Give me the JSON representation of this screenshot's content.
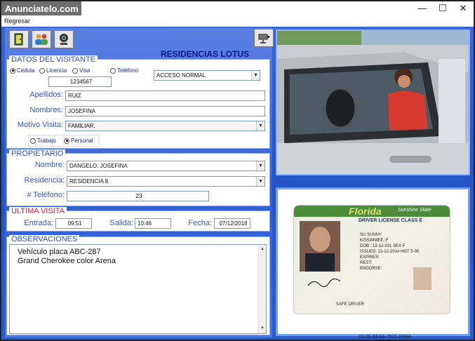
{
  "watermark": "Anunciatelo.com",
  "window_controls": {
    "minimize": "—",
    "maximize": "☐",
    "close": "✕"
  },
  "menu": {
    "regresar": "Regresar"
  },
  "app_title": "RESIDENCIAS LOTUS",
  "visitante": {
    "title": "DATOS DEL VISITANTE",
    "doc_types": [
      "Cédula",
      "Licencia",
      "Visa",
      "Teléfono"
    ],
    "doc_selected": "Cédula",
    "doc_number": "1234567",
    "access_type": "ACCESO NORMAL",
    "apellidos_label": "Apellidos:",
    "apellidos": "RUIZ",
    "nombres_label": "Nombres:",
    "nombres": "JOSEFINA",
    "motivo_label": "Motivo Visita:",
    "motivo": "FAMILIAR.",
    "visit_types": [
      "Trabajo",
      "Personal"
    ],
    "visit_selected": "Personal"
  },
  "propietario": {
    "title": "PROPIETARIO",
    "nombre_label": "Nombre:",
    "nombre": "DANGELO, JOSEFINA",
    "residencia_label": "Residencia:",
    "residencia": "RESIDENCIA 8",
    "telefono_label": "# Teléfono:",
    "telefono": "23"
  },
  "ultima_visita": {
    "title": "ULTIMA VISITA",
    "entrada_label": "Entrada:",
    "entrada": "09:51",
    "salida_label": "Salida:",
    "salida": "10:46",
    "fecha_label": "Fecha:",
    "fecha": "07/12/2018"
  },
  "observaciones": {
    "title": "OBSERVACIONES",
    "lines": [
      "Vehículo placa ABC-287",
      "Grand Cherokee color Arena"
    ]
  },
  "license": {
    "state": "Florida",
    "state_sub": "Sunshine State",
    "class": "DRIVER LICENSE CLASS E",
    "lines": [
      "SU SUNNY",
      "KISSIMMEE, F",
      "DOB : 12-12-201 SEX F",
      "ISSUED: 12-12-2014 HGT 5-05",
      "EXPIRES:",
      "REST:",
      "ENDORSE:"
    ],
    "footer": "SAFE DRIVER"
  },
  "status_code": "017B-BEA9-7021-E894",
  "colors": {
    "accent": "#2a5bd0",
    "label": "#3b58c9",
    "red": "#e0193c"
  }
}
